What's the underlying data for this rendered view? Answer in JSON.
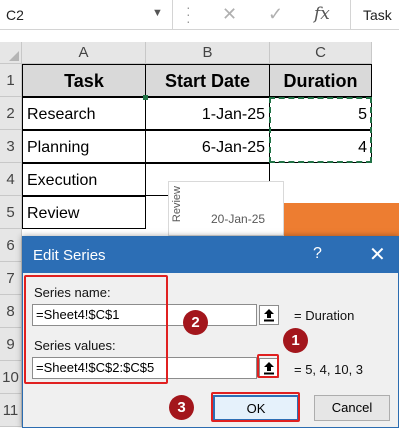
{
  "formula_bar": {
    "name_box": "C2",
    "cancel_icon": "✕",
    "enter_icon": "✓",
    "fx_label": "fx",
    "content": "Task"
  },
  "columns": [
    "A",
    "B",
    "C"
  ],
  "rows": [
    "1",
    "2",
    "3",
    "4",
    "5",
    "6",
    "7",
    "8",
    "9",
    "10",
    "11"
  ],
  "table": {
    "headers": [
      "Task",
      "Start Date",
      "Duration"
    ],
    "data": [
      [
        "Research",
        "1-Jan-25",
        "5"
      ],
      [
        "Planning",
        "6-Jan-25",
        "4"
      ],
      [
        "Execution",
        "",
        ""
      ],
      [
        "Review",
        "",
        ""
      ]
    ]
  },
  "chart": {
    "category_label": "Review",
    "tick_label": "20-Jan-25",
    "bar_color": "#ED7D31"
  },
  "dialog": {
    "title": "Edit Series",
    "help": "?",
    "close": "✕",
    "series_name_label": "Series name:",
    "series_name_value": "=Sheet4!$C$1",
    "series_name_preview": "= Duration",
    "series_values_label": "Series values:",
    "series_values_value": "=Sheet4!$C$2:$C$5",
    "series_values_preview": "= 5, 4, 10, 3",
    "ok_label": "OK",
    "cancel_label": "Cancel",
    "accent_color": "#2C6EB5"
  },
  "annotations": {
    "badges": [
      "1",
      "2",
      "3"
    ],
    "color": "#E02020"
  }
}
